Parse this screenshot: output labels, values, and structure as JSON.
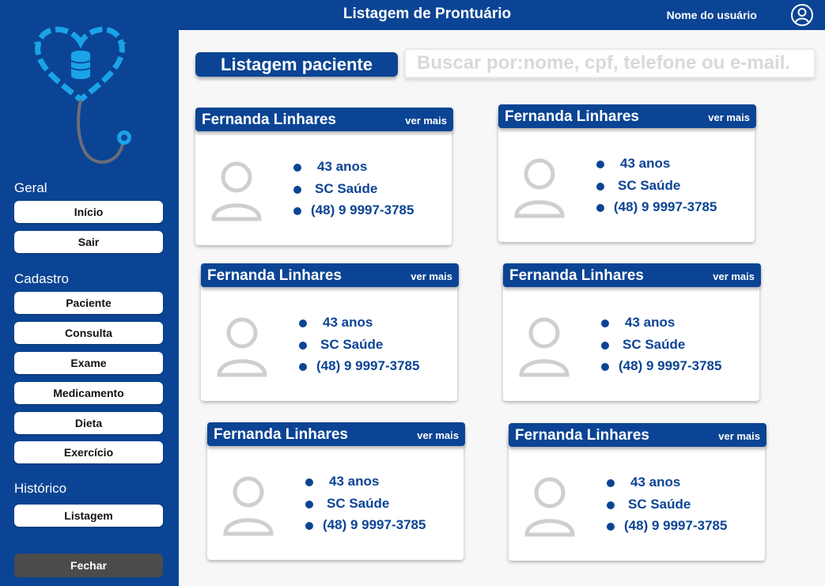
{
  "header": {
    "title": "Listagem de Prontuário",
    "user_name": "Nome do usuário"
  },
  "sidebar": {
    "sections": [
      {
        "title": "Geral",
        "items": [
          "Início",
          "Sair"
        ]
      },
      {
        "title": "Cadastro",
        "items": [
          "Paciente",
          "Consulta",
          "Exame",
          "Medicamento",
          "Dieta",
          "Exercício"
        ]
      },
      {
        "title": "Histórico",
        "items": [
          "Listagem"
        ]
      }
    ],
    "close_label": "Fechar"
  },
  "main": {
    "title": "Listagem paciente",
    "search_placeholder": "Buscar por:nome, cpf, telefone ou e-mail.",
    "more_label": "ver mais",
    "patients": [
      {
        "name": "Fernanda Linhares",
        "age": "43 anos",
        "plan": "SC Saúde",
        "phone": "(48) 9 9997-3785"
      },
      {
        "name": "Fernanda Linhares",
        "age": "43 anos",
        "plan": "SC Saúde",
        "phone": "(48) 9 9997-3785"
      },
      {
        "name": "Fernanda Linhares",
        "age": "43 anos",
        "plan": "SC Saúde",
        "phone": "(48) 9 9997-3785"
      },
      {
        "name": "Fernanda Linhares",
        "age": "43 anos",
        "plan": "SC Saúde",
        "phone": "(48) 9 9997-3785"
      },
      {
        "name": "Fernanda Linhares",
        "age": "43 anos",
        "plan": "SC Saúde",
        "phone": "(48) 9 9997-3785"
      },
      {
        "name": "Fernanda Linhares",
        "age": "43 anos",
        "plan": "SC Saúde",
        "phone": "(48) 9 9997-3785"
      }
    ]
  },
  "colors": {
    "brand": "#0b4494",
    "accent": "#1aa3e8",
    "close_button": "#4b4b4b"
  }
}
